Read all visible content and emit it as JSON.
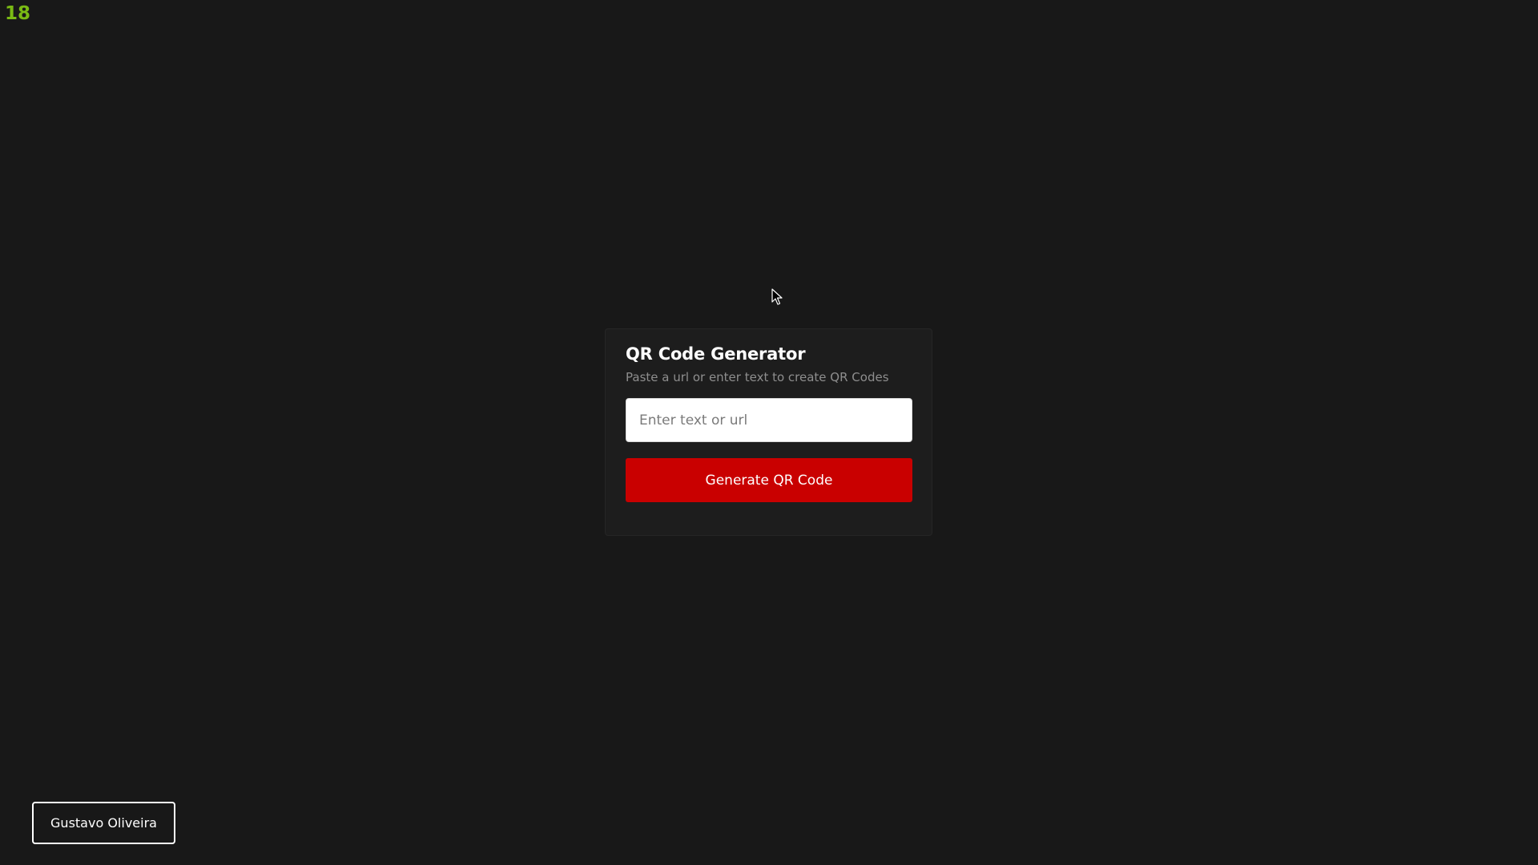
{
  "counter": "18",
  "card": {
    "title": "QR Code Generator",
    "subtitle": "Paste a url or enter text to create QR Codes",
    "input": {
      "placeholder": "Enter text or url",
      "value": ""
    },
    "button_label": "Generate QR Code"
  },
  "footer": {
    "author_label": "Gustavo Oliveira"
  },
  "icons": {
    "cursor": "mouse-pointer-icon"
  },
  "colors": {
    "background": "#181818",
    "card": "#1d1d1d",
    "accent": "#c90000",
    "counter": "#7aba14"
  }
}
